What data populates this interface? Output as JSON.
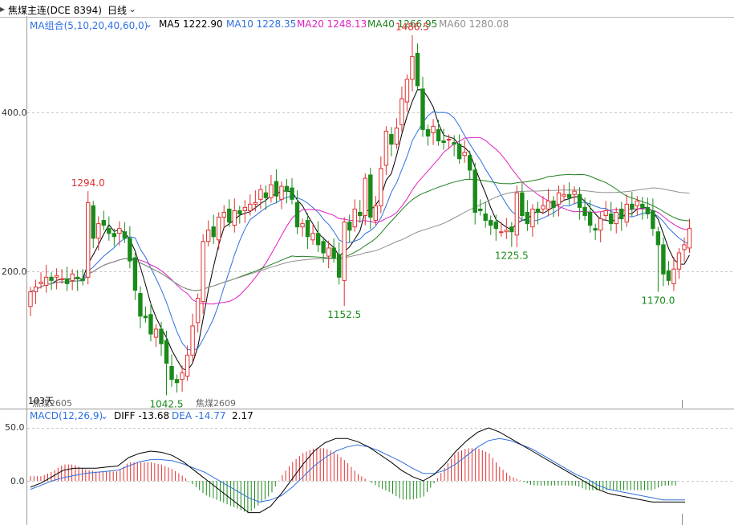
{
  "header": {
    "symbol": "焦煤主连(DCE 8394)",
    "period": "日线"
  },
  "ma_legend": {
    "group": "MA组合(5,10,20,40,60,0)",
    "ma5": "MA5 1222.90",
    "ma10": "MA10 1228.35",
    "ma20": "MA20 1248.13",
    "ma40": "MA40 1266.95",
    "ma60": "MA60 1280.08"
  },
  "macd_legend": {
    "name": "MACD(12,26,9)",
    "diff": "DIFF -13.68",
    "dea": "DEA -14.77",
    "macd": "2.17"
  },
  "colors": {
    "up": "#e03030",
    "down": "#1a8a1a",
    "ma5": "#000000",
    "ma10": "#3070e0",
    "ma20": "#e020c0",
    "ma40": "#208020",
    "ma60": "#909090",
    "diff": "#000000",
    "dea": "#3070e0",
    "grid": "#c8c8c8"
  },
  "chart_data": [
    {
      "type": "candlestick",
      "y_ticks": [
        "400.0",
        "200.0"
      ],
      "ylim": [
        1030,
        1500
      ],
      "ma_periods": [
        5,
        10,
        20,
        40,
        60
      ],
      "annotations": [
        {
          "label": "1294.0",
          "bar": 11,
          "value": 1294.0,
          "kind": "high"
        },
        {
          "label": "1486.5",
          "bar": 73,
          "value": 1486.5,
          "kind": "high"
        },
        {
          "label": "1042.5",
          "bar": 26,
          "value": 1042.5,
          "kind": "low"
        },
        {
          "label": "1152.5",
          "bar": 60,
          "value": 1152.5,
          "kind": "low"
        },
        {
          "label": "1225.5",
          "bar": 92,
          "value": 1225.5,
          "kind": "low"
        },
        {
          "label": "1170.0",
          "bar": 120,
          "value": 1170.0,
          "kind": "low"
        }
      ],
      "markers": [
        "103天",
        "焦煤2605",
        "焦煤2609"
      ],
      "closes": [
        1170,
        1176,
        1182,
        1188,
        1184,
        1190,
        1186,
        1180,
        1192,
        1186,
        1184,
        1280,
        1236,
        1254,
        1252,
        1242,
        1238,
        1248,
        1236,
        1208,
        1172,
        1140,
        1138,
        1118,
        1124,
        1106,
        1082,
        1062,
        1058,
        1070,
        1092,
        1128,
        1162,
        1232,
        1246,
        1238,
        1262,
        1268,
        1256,
        1270,
        1266,
        1274,
        1278,
        1280,
        1296,
        1286,
        1302,
        1288,
        1300,
        1294,
        1284,
        1250,
        1254,
        1238,
        1242,
        1228,
        1218,
        1224,
        1212,
        1188,
        1256,
        1246,
        1272,
        1264,
        1310,
        1262,
        1276,
        1322,
        1368,
        1352,
        1372,
        1408,
        1432,
        1460,
        1424,
        1370,
        1362,
        1374,
        1356,
        1354,
        1358,
        1352,
        1334,
        1342,
        1320,
        1268,
        1270,
        1258,
        1252,
        1248,
        1244,
        1246,
        1244,
        1292,
        1264,
        1254,
        1272,
        1268,
        1276,
        1282,
        1274,
        1292,
        1290,
        1286,
        1294,
        1274,
        1264,
        1252,
        1246,
        1260,
        1270,
        1254,
        1268,
        1260,
        1278,
        1272,
        1282,
        1274,
        1266,
        1248,
        1228,
        1192,
        1184,
        1198,
        1218,
        1228,
        1248
      ],
      "macd": {
        "diff": [
          -6,
          -2,
          4,
          10,
          12,
          12,
          12,
          13,
          14,
          22,
          26,
          28,
          27,
          24,
          18,
          10,
          2,
          -6,
          -14,
          -22,
          -30,
          -30,
          -24,
          -12,
          2,
          16,
          28,
          36,
          40,
          40,
          37,
          32,
          25,
          18,
          10,
          4,
          0,
          6,
          16,
          28,
          38,
          46,
          50,
          46,
          40,
          34,
          28,
          22,
          16,
          10,
          4,
          -2,
          -8,
          -12,
          -14,
          -16,
          -18,
          -20,
          -20,
          -20,
          -20
        ],
        "dea": [
          -8,
          -4,
          0,
          3,
          5,
          7,
          8,
          9,
          10,
          14,
          18,
          20,
          20,
          19,
          16,
          12,
          8,
          2,
          -4,
          -10,
          -16,
          -20,
          -18,
          -14,
          -6,
          4,
          14,
          22,
          28,
          32,
          34,
          32,
          28,
          23,
          18,
          12,
          7,
          7,
          10,
          16,
          24,
          32,
          38,
          40,
          38,
          34,
          30,
          24,
          18,
          12,
          6,
          2,
          -4,
          -8,
          -10,
          -12,
          -14,
          -16,
          -18,
          -18,
          -18
        ]
      }
    }
  ]
}
